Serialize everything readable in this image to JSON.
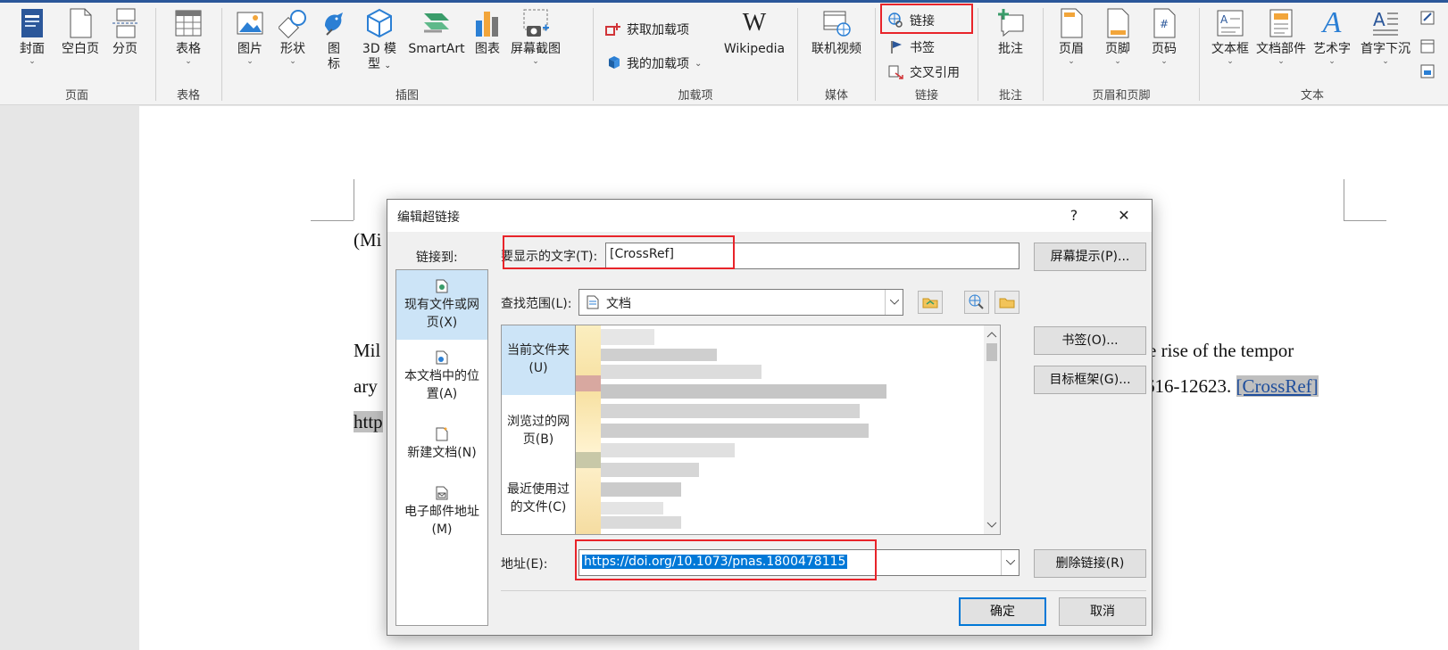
{
  "ribbon": {
    "groups": {
      "pages": "页面",
      "tables": "表格",
      "illustrations": "插图",
      "addins": "加载项",
      "media": "媒体",
      "links": "链接",
      "comments": "批注",
      "header_footer": "页眉和页脚",
      "text": "文本"
    },
    "buttons": {
      "cover": "封面",
      "blank_page": "空白页",
      "page_break": "分页",
      "table": "表格",
      "picture": "图片",
      "shapes": "形状",
      "icons_1": "图",
      "icons_2": "标",
      "model_1": "3D 模",
      "model_2": "型",
      "smartart": "SmartArt",
      "chart": "图表",
      "screenshot": "屏幕截图",
      "get_addins": "获取加载项",
      "my_addins": "我的加载项",
      "wikipedia": "Wikipedia",
      "online_video": "联机视频",
      "link": "链接",
      "bookmark": "书签",
      "cross_ref": "交叉引用",
      "comment": "批注",
      "header": "页眉",
      "footer": "页脚",
      "page_number": "页码",
      "textbox": "文本框",
      "quick_parts": "文档部件",
      "wordart": "艺术字",
      "dropcap": "首字下沉"
    }
  },
  "document": {
    "line1": "(Mi",
    "line2_start": "Mil",
    "line2_end": "e rise of the tempor",
    "line3_start": "ary",
    "line3_end": "616-12623. ",
    "line3_link": "[CrossRef]",
    "line4_start": "http"
  },
  "dialog": {
    "title": "编辑超链接",
    "help": "?",
    "close": "✕",
    "link_to": "链接到:",
    "nav": {
      "existing_1": "现有文件或网",
      "existing_2": "页(X)",
      "place_1": "本文档中的位",
      "place_2": "置(A)",
      "new_doc": "新建文档(N)",
      "email_1": "电子邮件地址",
      "email_2": "(M)"
    },
    "display_text_label": "要显示的文字(T):",
    "display_text_value": "[CrossRef]",
    "screentip_button": "屏幕提示(P)...",
    "look_in_label": "查找范围(L):",
    "look_in_value": "文档",
    "subnav": {
      "current_1": "当前文件夹",
      "current_2": "(U)",
      "browsed_1": "浏览过的网",
      "browsed_2": "页(B)",
      "recent_1": "最近使用过",
      "recent_2": "的文件(C)"
    },
    "bookmark_button": "书签(O)...",
    "target_frame_button": "目标框架(G)...",
    "address_label": "地址(E):",
    "address_value": "https://doi.org/10.1073/pnas.1800478115",
    "remove_link_button": "删除链接(R)",
    "ok_button": "确定",
    "cancel_button": "取消"
  },
  "colors": {
    "highlight_red": "#e8242a",
    "selection_blue": "#cce4f7",
    "ribbon_bg": "#f3f3f3"
  }
}
